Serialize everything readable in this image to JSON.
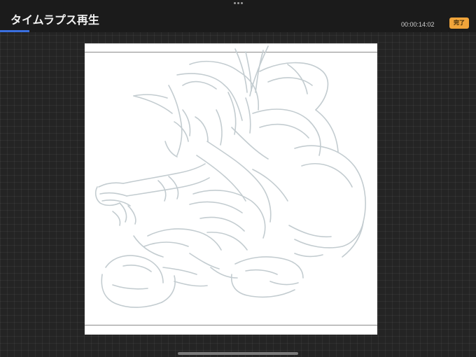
{
  "header": {
    "title": "タイムラプス再生",
    "timecode": "00:00:14:02",
    "done_label": "完了"
  },
  "icons": {
    "grabber": "more-dots-icon"
  },
  "colors": {
    "accent": "#3a6fe0",
    "done_button": "#f0a43a",
    "background": "#242424",
    "topbar": "#1b1b1b",
    "canvas": "#ffffff",
    "sketch_stroke": "#c3ccd0"
  }
}
